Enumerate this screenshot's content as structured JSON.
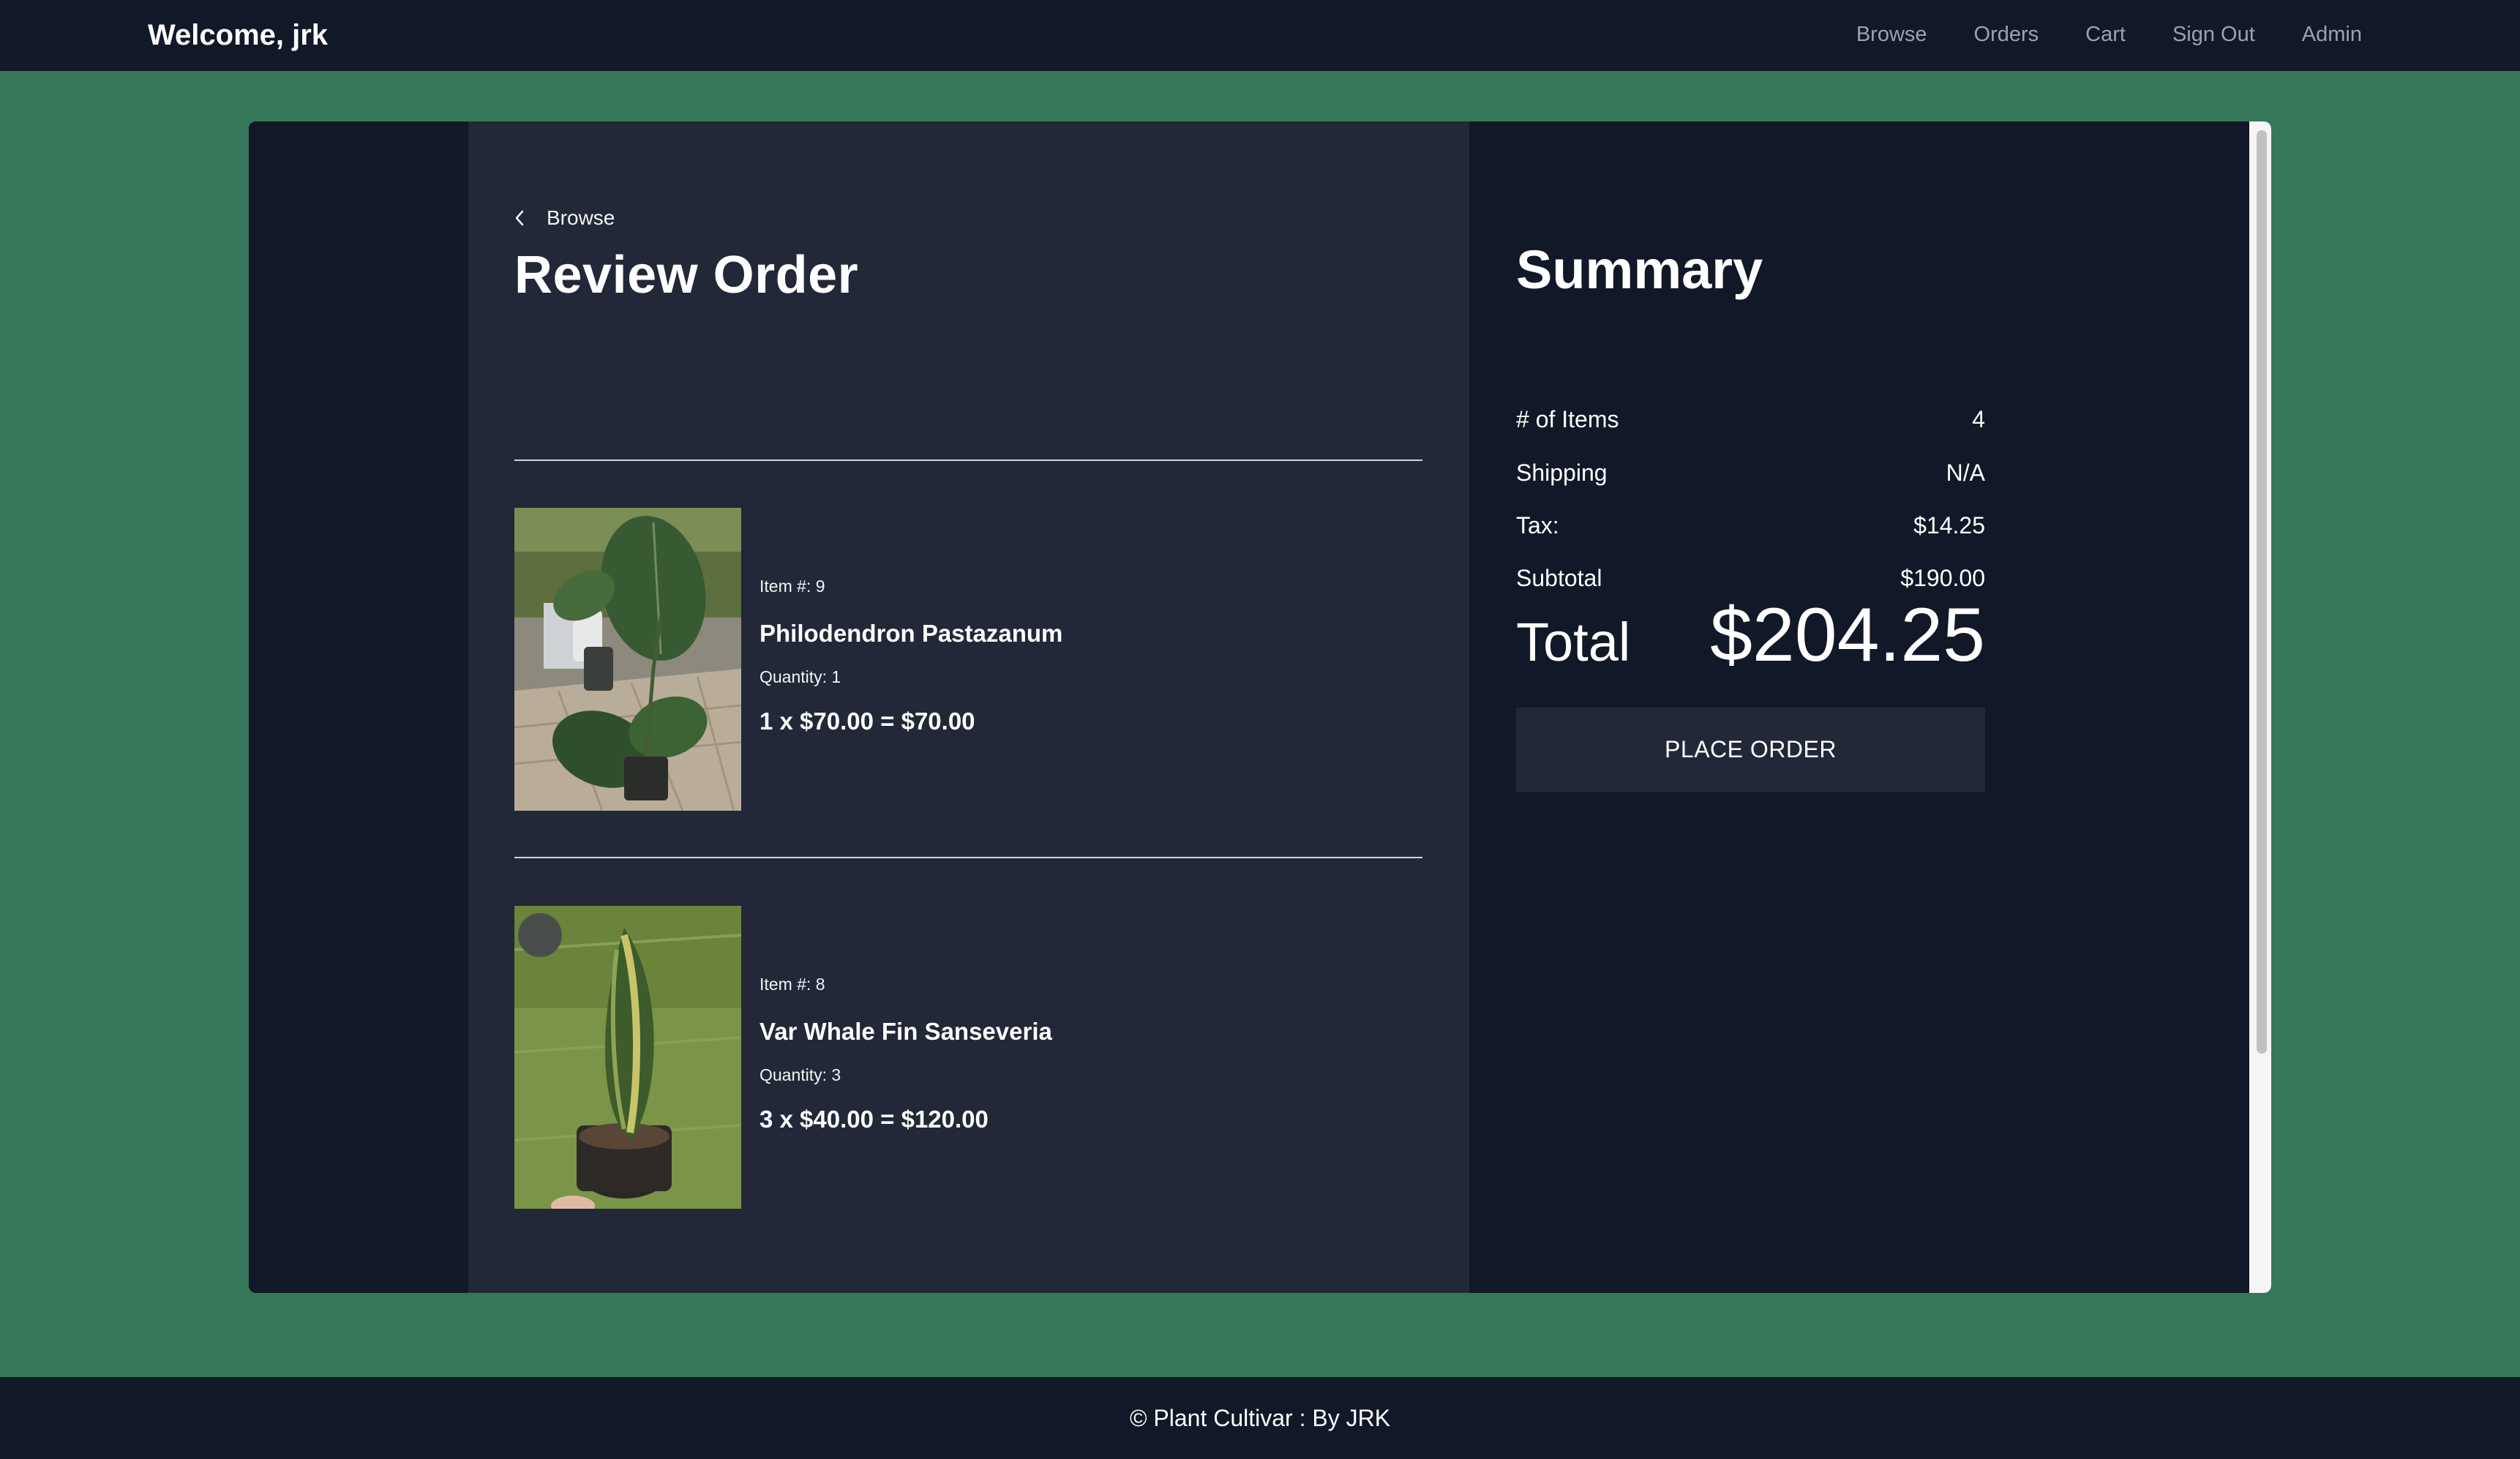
{
  "nav": {
    "brand": "Welcome, jrk",
    "links": [
      "Browse",
      "Orders",
      "Cart",
      "Sign Out",
      "Admin"
    ]
  },
  "review": {
    "back_label": "Browse",
    "title": "Review Order",
    "items": [
      {
        "item_number": "Item #: 9",
        "name": "Philodendron Pastazanum",
        "quantity": "Quantity: 1",
        "line_total": "1 x $70.00 = $70.00"
      },
      {
        "item_number": "Item #: 8",
        "name": "Var Whale Fin Sanseveria",
        "quantity": "Quantity: 3",
        "line_total": "3 x $40.00 = $120.00"
      }
    ]
  },
  "summary": {
    "title": "Summary",
    "rows": [
      {
        "label": "# of Items",
        "value": "4"
      },
      {
        "label": "Shipping",
        "value": "N/A"
      },
      {
        "label": "Tax:",
        "value": "$14.25"
      },
      {
        "label": "Subtotal",
        "value": "$190.00"
      }
    ],
    "total_label": "Total",
    "total_value": "$204.25",
    "place_order_label": "PLACE ORDER"
  },
  "footer": {
    "text": "© Plant Cultivar : By JRK"
  },
  "colors": {
    "page_bg": "#36775a",
    "nav_bg": "#111827",
    "review_bg": "#222837",
    "summary_bg": "#111827",
    "button_bg": "#222837"
  }
}
